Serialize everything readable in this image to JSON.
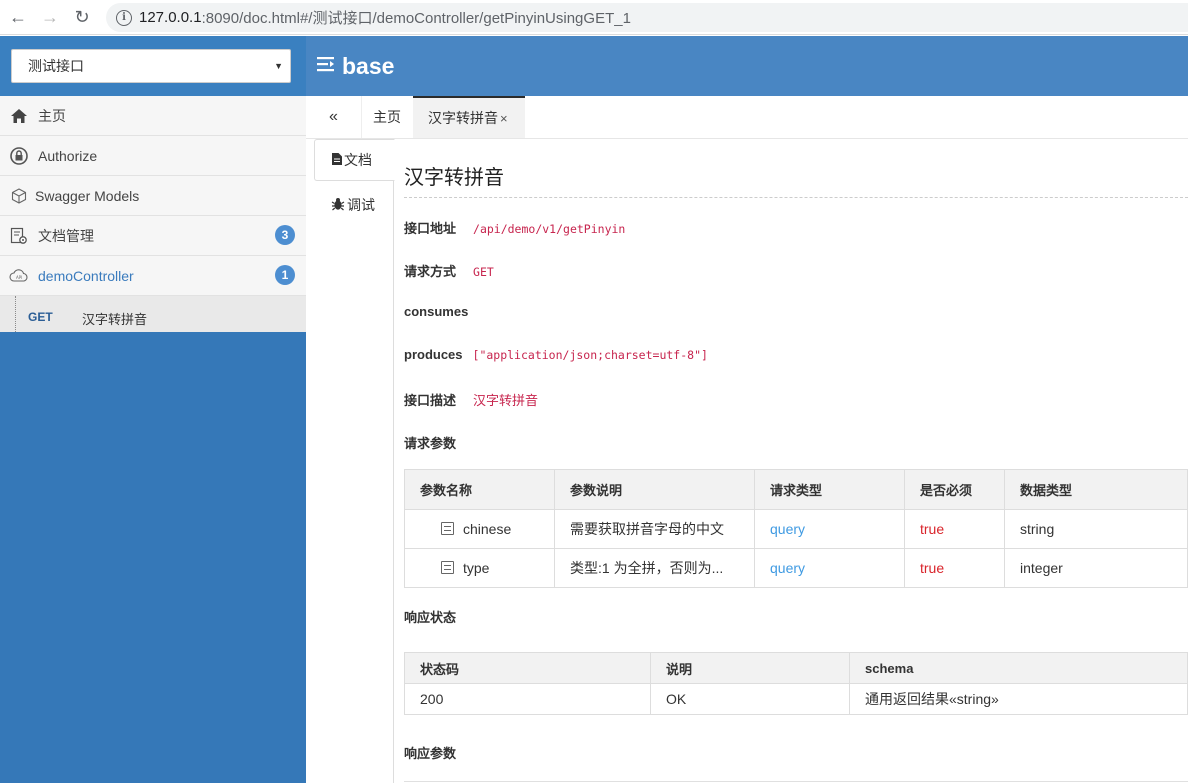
{
  "browser": {
    "url_host": "127.0.0.1",
    "url_rest": ":8090/doc.html#/测试接口/demoController/getPinyinUsingGET_1"
  },
  "sidebar": {
    "group_select": "测试接口",
    "items": [
      {
        "label": "主页",
        "icon": "home-icon"
      },
      {
        "label": "Authorize",
        "icon": "lock-icon"
      },
      {
        "label": "Swagger Models",
        "icon": "cube-icon"
      },
      {
        "label": "文档管理",
        "icon": "doc-settings-icon",
        "badge": "3"
      },
      {
        "label": "demoController",
        "icon": "api-cloud-icon",
        "badge": "1"
      }
    ],
    "sub_item": {
      "method": "GET",
      "label": "汉字转拼音"
    }
  },
  "header": {
    "brand": "base"
  },
  "tabs": {
    "home": "主页",
    "current": "汉字转拼音",
    "close": "×"
  },
  "vtabs": {
    "doc": "文档",
    "debug": "调试"
  },
  "doc": {
    "title": "汉字转拼音",
    "api_address_label": "接口地址",
    "api_address": "/api/demo/v1/getPinyin",
    "method_label": "请求方式",
    "method": "GET",
    "consumes_label": "consumes",
    "produces_label": "produces",
    "produces": "[\"application/json;charset=utf-8\"]",
    "desc_label": "接口描述",
    "desc": "汉字转拼音",
    "request_params_label": "请求参数",
    "params_headers": [
      "参数名称",
      "参数说明",
      "请求类型",
      "是否必须",
      "数据类型"
    ],
    "params_rows": [
      {
        "name": "chinese",
        "desc": "需要获取拼音字母的中文",
        "in": "query",
        "required": "true",
        "type": "string"
      },
      {
        "name": "type",
        "desc": "类型:1 为全拼，否则为...",
        "in": "query",
        "required": "true",
        "type": "integer"
      }
    ],
    "response_status_label": "响应状态",
    "status_headers": [
      "状态码",
      "说明",
      "schema"
    ],
    "status_rows": [
      {
        "code": "200",
        "desc": "OK",
        "schema": "通用返回结果«string»"
      }
    ],
    "response_params_label": "响应参数"
  },
  "colors": {
    "sidebar_bg": "#3578b8",
    "header_bg": "#4986c3",
    "code_red": "#c7254e",
    "query_blue": "#3f9ae2",
    "true_red": "#d9242b",
    "badge_blue": "#4d8ed1"
  }
}
